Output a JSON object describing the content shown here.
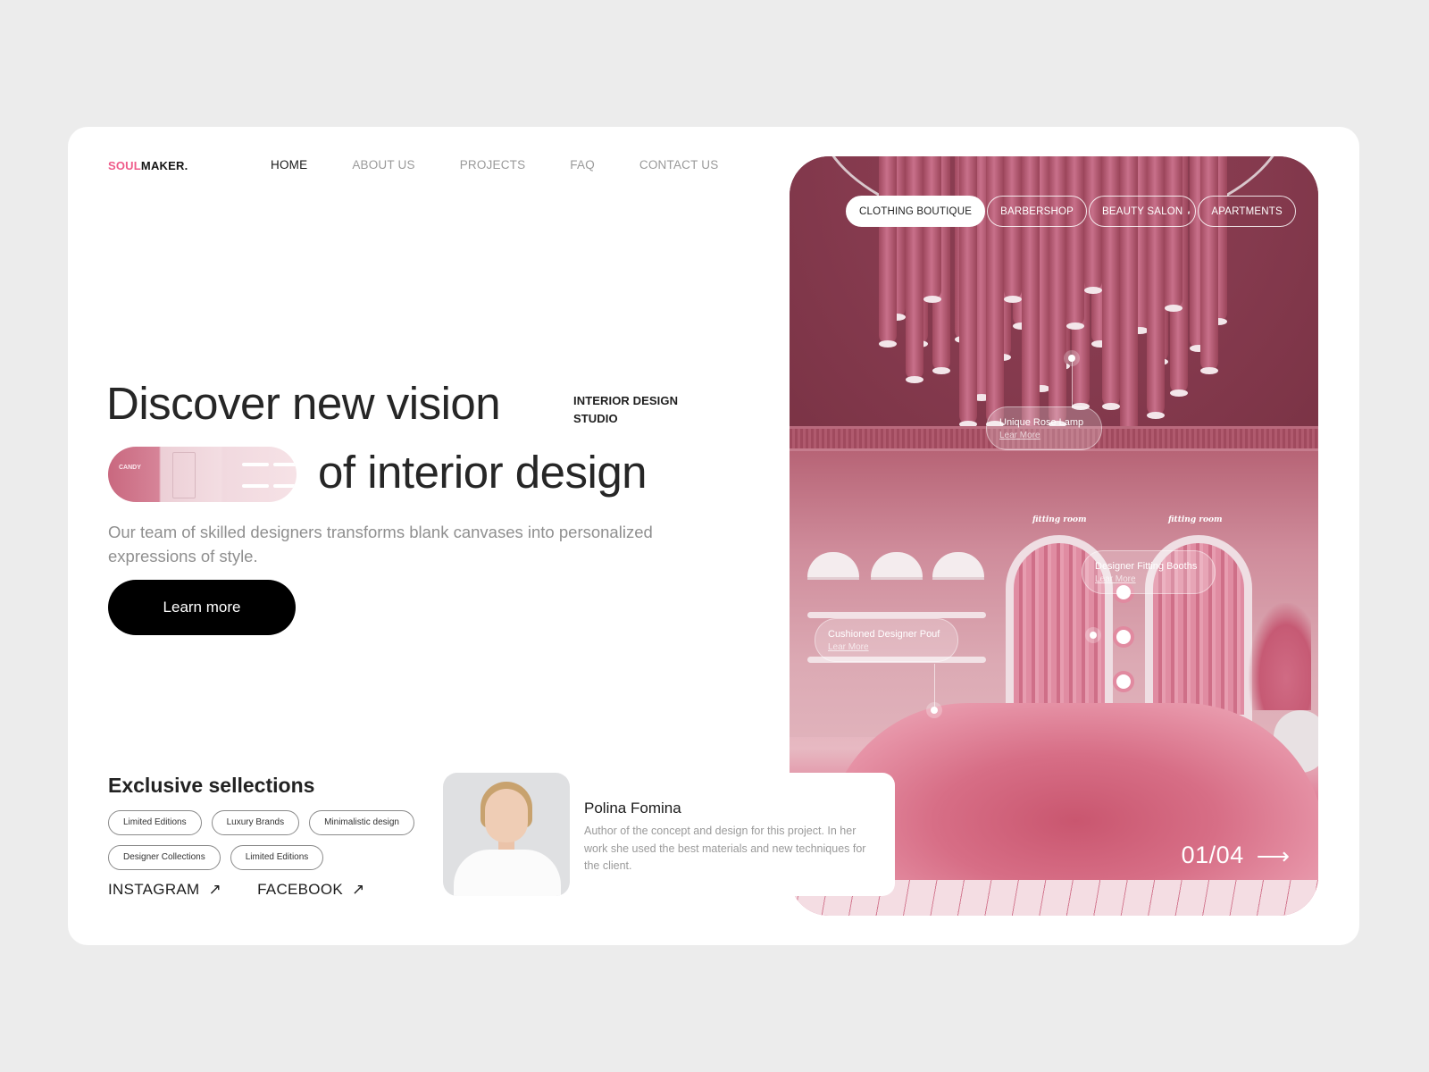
{
  "brand": {
    "accent": "SOUL",
    "rest": "MAKER.",
    "accent_color": "#ef5b8a"
  },
  "nav": {
    "items": [
      {
        "label": "HOME",
        "active": true
      },
      {
        "label": "ABOUT US",
        "active": false
      },
      {
        "label": "PROJECTS",
        "active": false
      },
      {
        "label": "FAQ",
        "active": false
      },
      {
        "label": "CONTACT US",
        "active": false
      }
    ]
  },
  "hero": {
    "line1": "Discover new vision",
    "line2": "of interior design",
    "studio_line1": "INTERIOR DESIGN",
    "studio_line2": "STUDIO",
    "thumb_sign": "CANDY",
    "subtitle": "Our team of skilled designers transforms blank canvases into personalized expressions of style.",
    "cta_label": "Learn more"
  },
  "selections": {
    "title": "Exclusive sellections",
    "tags": [
      "Limited Editions",
      "Luxury Brands",
      "Minimalistic design",
      "Designer Collections",
      "Limited Editions"
    ]
  },
  "socials": [
    {
      "label": "INSTAGRAM",
      "icon": "arrow-up-right-icon",
      "glyph": "↗"
    },
    {
      "label": "FACEBOOK",
      "icon": "arrow-up-right-icon",
      "glyph": "↗"
    }
  ],
  "author": {
    "name": "Polina Fomina",
    "description": "Author of the concept and design for this project. In her work she used the best materials and new techniques for the client."
  },
  "showcase": {
    "categories": [
      {
        "label": "CLOTHING BOUTIQUE",
        "active": true
      },
      {
        "label": "BARBERSHOP",
        "active": false
      },
      {
        "label": "BEAUTY SALON",
        "active": false
      },
      {
        "label": "APARTMENTS",
        "active": false
      }
    ],
    "hotspots": [
      {
        "title": "Unique Rose Lamp",
        "link": "Lear More"
      },
      {
        "title": "Designer Fitting Booths",
        "link": "Lear More"
      },
      {
        "title": "Cushioned Designer Pouf",
        "link": "Lear More"
      }
    ],
    "room_signs": [
      "fitting room",
      "fitting room"
    ],
    "counter": "01/04",
    "next_glyph": "⟶"
  }
}
